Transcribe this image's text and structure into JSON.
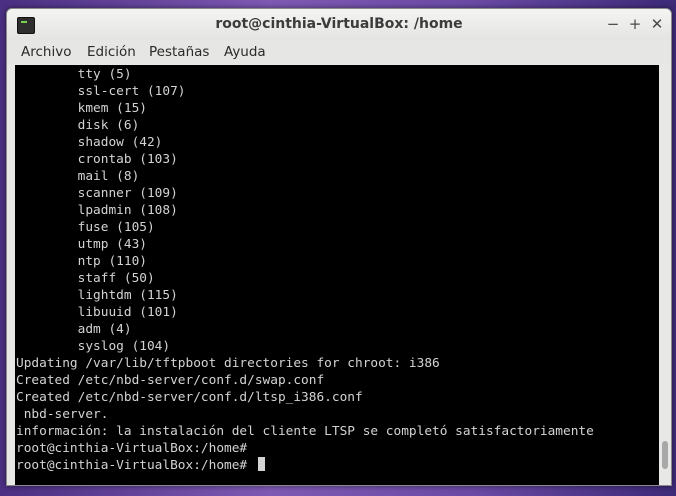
{
  "window": {
    "title": "root@cinthia-VirtualBox: /home",
    "buttons": {
      "minimize": "−",
      "maximize": "+",
      "close": "✕"
    }
  },
  "menu": {
    "archivo": "Archivo",
    "edicion": "Edición",
    "pestanas": "Pestañas",
    "ayuda": "Ayuda"
  },
  "terminal": {
    "lines": [
      "        tty (5)",
      "        ssl-cert (107)",
      "        kmem (15)",
      "        disk (6)",
      "        shadow (42)",
      "        crontab (103)",
      "        mail (8)",
      "        scanner (109)",
      "        lpadmin (108)",
      "        fuse (105)",
      "        utmp (43)",
      "        ntp (110)",
      "        staff (50)",
      "        lightdm (115)",
      "        libuuid (101)",
      "        adm (4)",
      "        syslog (104)",
      "Updating /var/lib/tftpboot directories for chroot: i386",
      "Created /etc/nbd-server/conf.d/swap.conf",
      "Created /etc/nbd-server/conf.d/ltsp_i386.conf",
      " nbd-server.",
      "información: la instalación del cliente LTSP se completó satisfactoriamente",
      "root@cinthia-VirtualBox:/home#",
      "root@cinthia-VirtualBox:/home# "
    ]
  },
  "icons": {
    "app": "terminal-icon",
    "minimize": "minimize-icon",
    "maximize": "maximize-icon",
    "close": "close-icon"
  },
  "colors": {
    "terminal_bg": "#000000",
    "terminal_fg": "#d3d3d3",
    "titlebar": "#ececeb"
  }
}
